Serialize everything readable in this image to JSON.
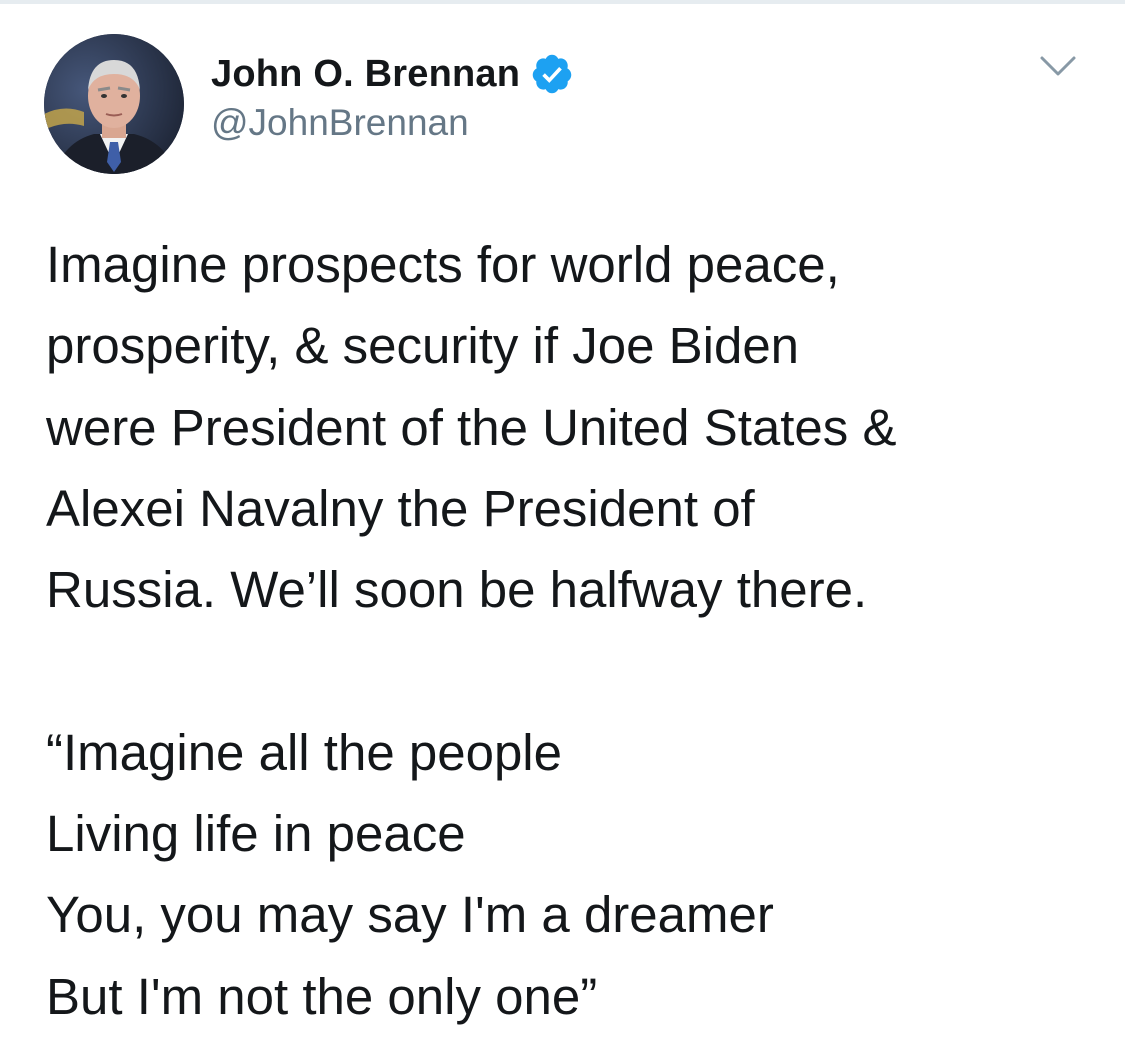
{
  "author": {
    "display_name": "John O. Brennan",
    "handle": "@JohnBrennan",
    "verified": true,
    "verified_color": "#1da1f2"
  },
  "menu": {
    "icon": "chevron-down-icon"
  },
  "tweet": {
    "paragraph_1": "Imagine prospects for world peace,\nprosperity, & security if Joe Biden\nwere President of the United States &\nAlexei Navalny the President of\nRussia. We’ll soon be halfway there.",
    "paragraph_2": "“Imagine all the people\nLiving life in peace\nYou, you may say I'm a dreamer\nBut I'm not the only one”"
  },
  "colors": {
    "text": "#14171a",
    "secondary_text": "#657786",
    "divider": "#e6ecf0"
  }
}
